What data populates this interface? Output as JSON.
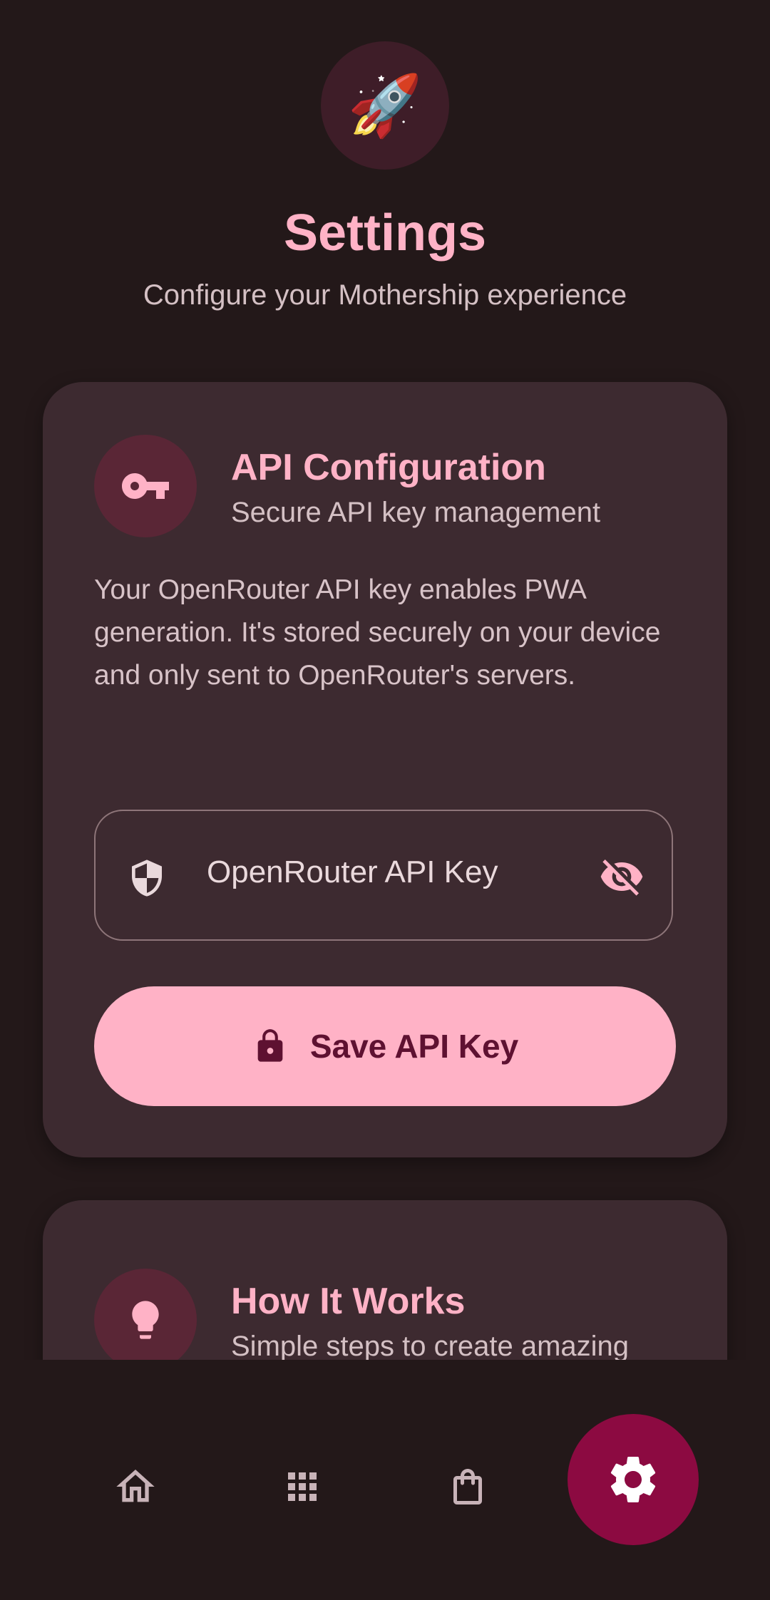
{
  "header": {
    "logo_emoji": "🚀",
    "title": "Settings",
    "subtitle": "Configure your Mothership experience"
  },
  "api_card": {
    "icon": "key-icon",
    "title": "API Configuration",
    "subtitle": "Secure API key management",
    "description": "Your OpenRouter API key enables PWA generation. It's stored securely on your device and only sent to OpenRouter's servers.",
    "field": {
      "label": "OpenRouter API Key",
      "leading_icon": "shield-icon",
      "trailing_icon": "visibility-off-icon"
    },
    "save_button": {
      "icon": "lock-icon",
      "label": "Save API Key"
    }
  },
  "how_card": {
    "icon": "lightbulb-icon",
    "title": "How It Works",
    "subtitle": "Simple steps to create amazing PWA..."
  },
  "bottom_nav": {
    "items": [
      {
        "icon": "home-icon",
        "active": false
      },
      {
        "icon": "apps-grid-icon",
        "active": false
      },
      {
        "icon": "shopping-bag-icon",
        "active": false
      },
      {
        "icon": "gear-icon",
        "active": true
      }
    ]
  },
  "colors": {
    "background": "#231819",
    "card": "#3d2a30",
    "accent": "#ffb2c6",
    "accent_dark": "#5e1131",
    "nav_active": "#8c0a41"
  }
}
